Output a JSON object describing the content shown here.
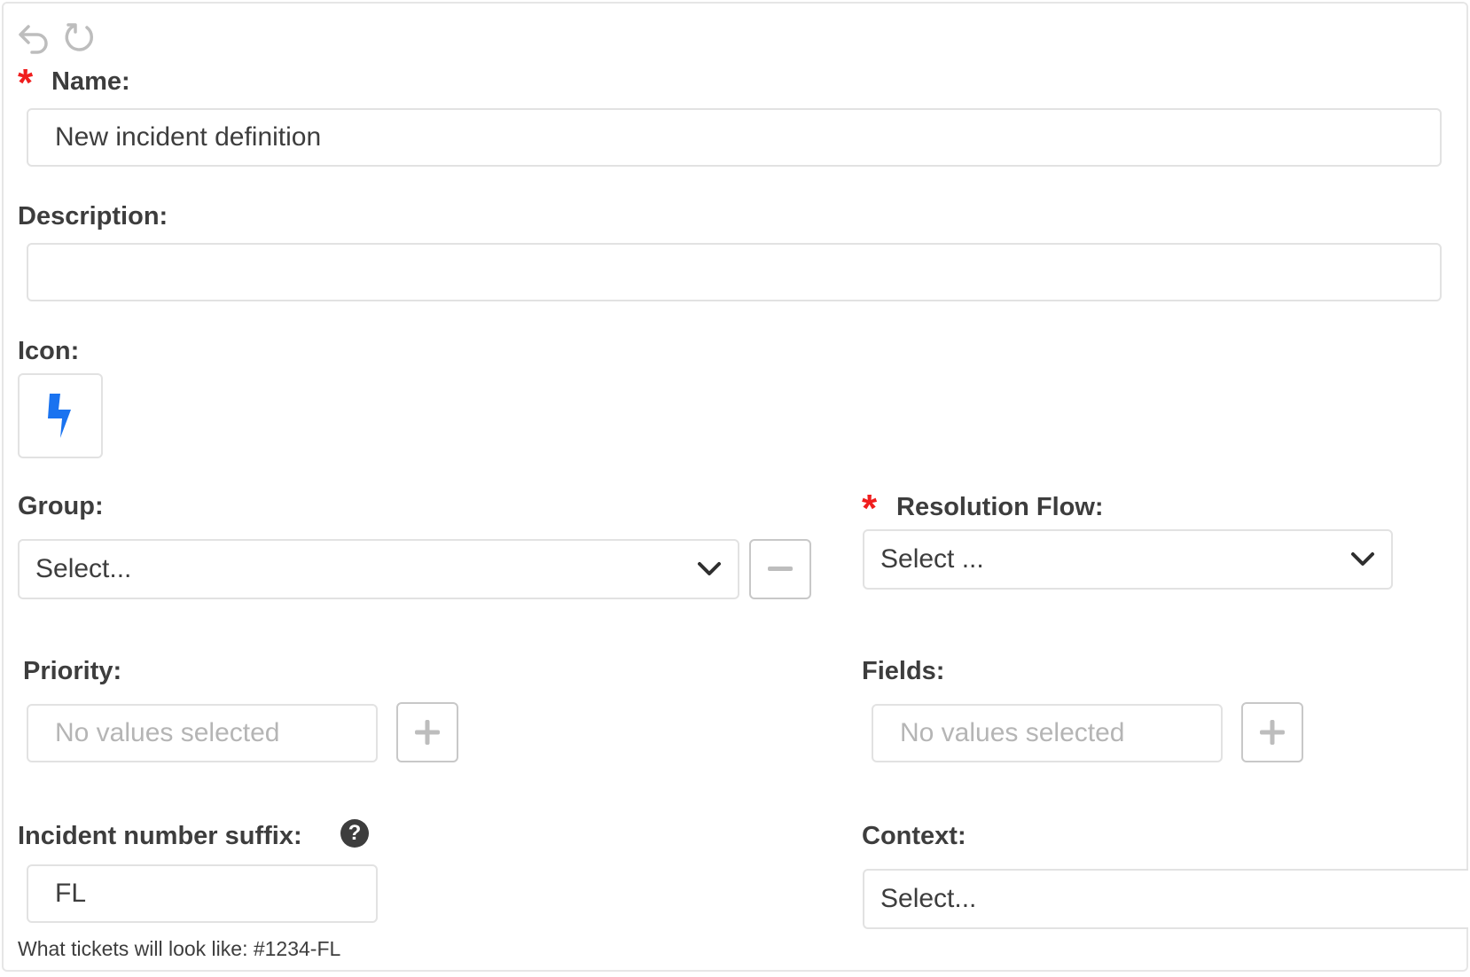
{
  "toolbar": {
    "undo_icon": "undo-arrow-icon",
    "redo_icon": "redo-arrow-icon"
  },
  "form": {
    "name": {
      "label": "Name:",
      "required": true,
      "value": "New incident definition"
    },
    "description": {
      "label": "Description:",
      "value": ""
    },
    "icon": {
      "label": "Icon:",
      "icon_name": "lightning-bolt-icon",
      "color": "#1a73f0"
    },
    "group": {
      "label": "Group:",
      "placeholder": "Select..."
    },
    "resolution_flow": {
      "label": "Resolution Flow:",
      "required": true,
      "placeholder": "Select ..."
    },
    "priority": {
      "label": "Priority:",
      "placeholder": "No values selected"
    },
    "fields": {
      "label": "Fields:",
      "placeholder": "No values selected"
    },
    "suffix": {
      "label": "Incident number suffix:",
      "help": "?",
      "value": "FL",
      "hint": "What tickets will look like: #1234-FL"
    },
    "context": {
      "label": "Context:",
      "placeholder": "Select..."
    }
  },
  "colors": {
    "required": "#f01e1e",
    "text": "#3d3d3d",
    "placeholder": "#b5b5b5",
    "border": "#e2e2e2",
    "accent": "#1a73f0"
  }
}
